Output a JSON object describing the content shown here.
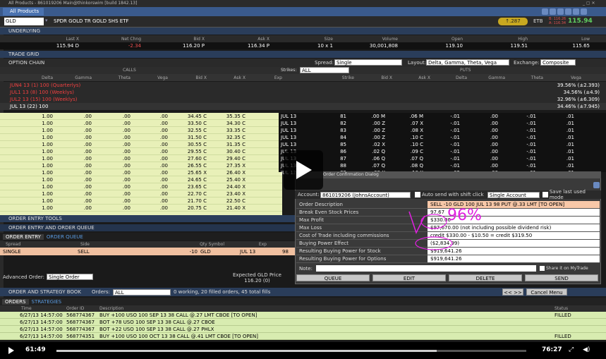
{
  "window": {
    "title": "All Products - 861019206 Main@thinkorswim [build 1842.13]"
  },
  "tabbar": {
    "tab": "All Products"
  },
  "symbol": {
    "value": "GLD",
    "name": "SPDR GOLD TR GOLD SHS ETF",
    "price_badge": "↑.287",
    "etb": "ETB",
    "bid_small": "B: 116.26",
    "ask_small": "A: 116.34",
    "last": "115.94"
  },
  "underlying": {
    "title": "UNDERLYING",
    "headers": [
      "Last X",
      "Net Chng",
      "Bid X",
      "Ask X",
      "Size",
      "Volume",
      "Open",
      "High",
      "Low"
    ],
    "values": [
      "115.94 D",
      "-2.34",
      "116.20 P",
      "116.34 P",
      "10 x 1",
      "30,001,808",
      "119.10",
      "119.51",
      "115.65"
    ]
  },
  "trade_grid": {
    "title": "TRADE GRID"
  },
  "option_chain": {
    "title": "OPTION CHAIN",
    "spread_label": "Spread:",
    "spread": "Single",
    "layout_label": "Layout:",
    "layout": "Delta, Gamma, Theta, Vega",
    "exchange_label": "Exchange:",
    "exchange": "Composite",
    "strikes_label": "Strikes:",
    "strikes": "ALL",
    "calls": "CALLS",
    "puts": "PUTS"
  },
  "call_headers": [
    "Delta",
    "Gamma",
    "Theta",
    "Vega",
    "Bid X",
    "Ask X"
  ],
  "mid_headers": [
    "Exp",
    "Strike"
  ],
  "put_headers": [
    "Bid X",
    "Ask X",
    "Delta",
    "Gamma",
    "Theta",
    "Vega"
  ],
  "expirations": [
    {
      "label": "JUN4 13   (1)  100 (Quarterlys)",
      "iv": "39.56% (±2.393)"
    },
    {
      "label": "JUL1 13   (8)  100 (Weeklys)",
      "iv": "34.56% (±4.9)"
    },
    {
      "label": "JUL2 13   (15)  100 (Weeklys)",
      "iv": "32.96% (±6.309)"
    },
    {
      "label": "JUL 13   (22)  100",
      "iv": "34.46% (±7.945)"
    }
  ],
  "call_rows": [
    [
      "1.00",
      ".00",
      ".00",
      ".00",
      "34.45 C",
      "35.35 C"
    ],
    [
      "1.00",
      ".00",
      ".00",
      ".00",
      "33.50 C",
      "34.30 C"
    ],
    [
      "1.00",
      ".00",
      ".00",
      ".00",
      "32.55 C",
      "33.35 C"
    ],
    [
      "1.00",
      ".00",
      ".00",
      ".00",
      "31.50 C",
      "32.35 C"
    ],
    [
      "1.00",
      ".00",
      ".00",
      ".00",
      "30.55 C",
      "31.35 C"
    ],
    [
      "1.00",
      ".00",
      ".00",
      ".00",
      "29.55 C",
      "30.40 C"
    ],
    [
      "1.00",
      ".00",
      ".00",
      ".00",
      "27.60 C",
      "29.40 C"
    ],
    [
      "1.00",
      ".00",
      ".00",
      ".00",
      "26.55 C",
      "27.35 X"
    ],
    [
      "1.00",
      ".00",
      ".00",
      ".00",
      "25.65 X",
      "26.40 X"
    ],
    [
      "1.00",
      ".00",
      ".00",
      ".00",
      "24.65 C",
      "25.40 X"
    ],
    [
      "1.00",
      ".00",
      ".00",
      ".00",
      "23.65 C",
      "24.40 X"
    ],
    [
      "1.00",
      ".00",
      ".00",
      ".00",
      "22.70 C",
      "23.40 X"
    ],
    [
      "1.00",
      ".00",
      ".00",
      ".00",
      "21.70 C",
      "22.50 C"
    ],
    [
      "1.00",
      ".00",
      ".00",
      ".00",
      "20.75 C",
      "21.40 X"
    ]
  ],
  "put_rows": [
    [
      "JUL 13",
      "81",
      ".00 M",
      ".06 M",
      "-.01",
      ".00",
      "-.01",
      ".01"
    ],
    [
      "JUL 13",
      "82",
      ".00 Z",
      ".07 X",
      "-.01",
      ".00",
      "-.01",
      ".01"
    ],
    [
      "JUL 13",
      "83",
      ".00 Z",
      ".08 X",
      "-.01",
      ".00",
      "-.01",
      ".01"
    ],
    [
      "JUL 13",
      "84",
      ".00 Z",
      ".10 C",
      "-.01",
      ".00",
      "-.01",
      ".01"
    ],
    [
      "JUL 13",
      "85",
      ".02 X",
      ".10 C",
      "-.01",
      ".00",
      "-.01",
      ".01"
    ],
    [
      "JUL 13",
      "86",
      ".02 Q",
      ".09 C",
      "-.01",
      ".00",
      "-.01",
      ".01"
    ],
    [
      "JUL 13",
      "87",
      ".06 Q",
      ".07 Q",
      "-.01",
      ".00",
      "-.01",
      ".01"
    ],
    [
      "JUL 13",
      "88",
      ".07 Q",
      ".08 Q",
      "-.01",
      ".00",
      "-.01",
      ".01"
    ],
    [
      "JUL 13",
      "89",
      ".08 X",
      ".10 X",
      "-.02",
      ".00",
      "-.01",
      ".01"
    ]
  ],
  "order_entry": {
    "tools": "ORDER ENTRY TOOLS",
    "queue_title": "ORDER ENTRY AND ORDER QUEUE",
    "tab1": "ORDER ENTRY",
    "tab2": "ORDER QUEUE",
    "headers": [
      "Spread",
      "Side",
      "Qty Symbol",
      "Exp"
    ],
    "row": {
      "spread": "SINGLE",
      "side": "SELL",
      "qty": "-10",
      "symbol": "GLD",
      "exp": "JUL 13",
      "strike": "98"
    },
    "advanced_label": "Advanced Order:",
    "advanced": "Single Order",
    "expected_label": "Expected GLD Price",
    "expected": "116.20 (0)"
  },
  "orderbook": {
    "title": "ORDER AND STRATEGY BOOK",
    "orders_label": "Orders:",
    "orders": "ALL",
    "summary": "0 working, 20 filled orders, 45 total fills",
    "nav": "<< >>",
    "cancel": "Cancel Menu",
    "tab1": "ORDERS",
    "tab2": "STRATEGIES",
    "headers": [
      "Time",
      "Order ID",
      "Description",
      "Status"
    ],
    "rows": [
      [
        "6/27/13 14:57:00",
        "568774367",
        "BUY +100 USO 100 SEP 13 38 CALL @.27 LMT CBOE [TO OPEN]",
        "FILLED"
      ],
      [
        "6/27/13 14:57:00",
        "568774367",
        "BOT +78 USO 100 SEP 13 38 CALL @.27 CBOE",
        ""
      ],
      [
        "6/27/13 14:57:00",
        "568774367",
        "BOT +22 USO 100 SEP 13 38 CALL @.27 PHLX",
        ""
      ],
      [
        "6/27/13 14:57:00",
        "568774351",
        "BUY +100 USO 100 OCT 13 38 CALL @.41 LMT CBOE [TO OPEN]",
        "FILLED"
      ]
    ]
  },
  "dialog": {
    "title": "Order Confirmation Dialog",
    "account_label": "Account:",
    "account": "861019206 (JohnsAccount)",
    "auto_send": "Auto send with shift click",
    "single_account": "Single Account",
    "save_last": "Save last used mode",
    "rows": [
      {
        "k": "Order Description",
        "v": "SELL -10 GLD 100 JUL 13 98 PUT @.33 LMT [TO OPEN]"
      },
      {
        "k": "Break Even Stock Prices",
        "v": "97.67"
      },
      {
        "k": "Max Profit",
        "v": "$330.00"
      },
      {
        "k": "Max Loss",
        "v": "$97,670.00 (not including possible dividend risk)"
      },
      {
        "k": "Cost of Trade including commissions",
        "v": "credit $330.00 - $10.50 = credit $319.50"
      },
      {
        "k": "Buying Power Effect",
        "v": "($2,834.99)"
      },
      {
        "k": "Resulting Buying Power for Stock",
        "v": "$919,641.26"
      },
      {
        "k": "Resulting Buying Power for Options",
        "v": "$919,641.26"
      }
    ],
    "note_label": "Note:",
    "share": "Share it on MyTrade",
    "queue": "QUEUE",
    "edit": "EDIT",
    "delete": "DELETE",
    "send": "SEND"
  },
  "annotation": {
    "text": "96%"
  },
  "video": {
    "current": "61:49",
    "total": "76:27"
  }
}
